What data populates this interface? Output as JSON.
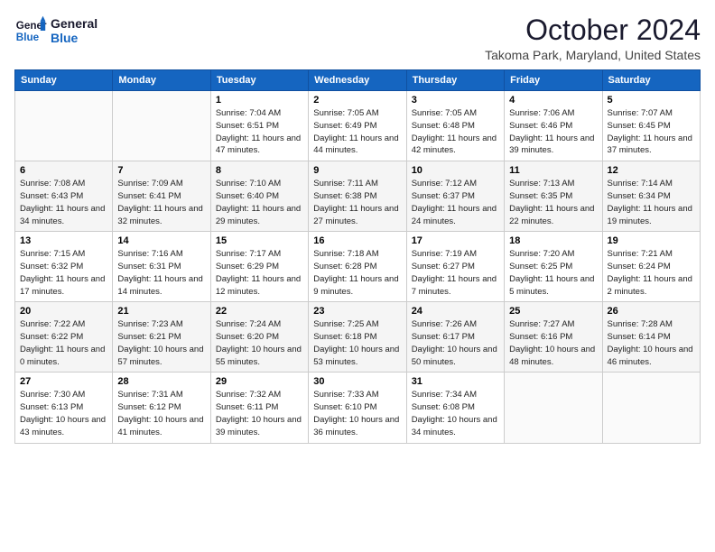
{
  "header": {
    "logo_line1": "General",
    "logo_line2": "Blue",
    "month": "October 2024",
    "location": "Takoma Park, Maryland, United States"
  },
  "weekdays": [
    "Sunday",
    "Monday",
    "Tuesday",
    "Wednesday",
    "Thursday",
    "Friday",
    "Saturday"
  ],
  "weeks": [
    [
      {
        "day": "",
        "info": ""
      },
      {
        "day": "",
        "info": ""
      },
      {
        "day": "1",
        "info": "Sunrise: 7:04 AM\nSunset: 6:51 PM\nDaylight: 11 hours and 47 minutes."
      },
      {
        "day": "2",
        "info": "Sunrise: 7:05 AM\nSunset: 6:49 PM\nDaylight: 11 hours and 44 minutes."
      },
      {
        "day": "3",
        "info": "Sunrise: 7:05 AM\nSunset: 6:48 PM\nDaylight: 11 hours and 42 minutes."
      },
      {
        "day": "4",
        "info": "Sunrise: 7:06 AM\nSunset: 6:46 PM\nDaylight: 11 hours and 39 minutes."
      },
      {
        "day": "5",
        "info": "Sunrise: 7:07 AM\nSunset: 6:45 PM\nDaylight: 11 hours and 37 minutes."
      }
    ],
    [
      {
        "day": "6",
        "info": "Sunrise: 7:08 AM\nSunset: 6:43 PM\nDaylight: 11 hours and 34 minutes."
      },
      {
        "day": "7",
        "info": "Sunrise: 7:09 AM\nSunset: 6:41 PM\nDaylight: 11 hours and 32 minutes."
      },
      {
        "day": "8",
        "info": "Sunrise: 7:10 AM\nSunset: 6:40 PM\nDaylight: 11 hours and 29 minutes."
      },
      {
        "day": "9",
        "info": "Sunrise: 7:11 AM\nSunset: 6:38 PM\nDaylight: 11 hours and 27 minutes."
      },
      {
        "day": "10",
        "info": "Sunrise: 7:12 AM\nSunset: 6:37 PM\nDaylight: 11 hours and 24 minutes."
      },
      {
        "day": "11",
        "info": "Sunrise: 7:13 AM\nSunset: 6:35 PM\nDaylight: 11 hours and 22 minutes."
      },
      {
        "day": "12",
        "info": "Sunrise: 7:14 AM\nSunset: 6:34 PM\nDaylight: 11 hours and 19 minutes."
      }
    ],
    [
      {
        "day": "13",
        "info": "Sunrise: 7:15 AM\nSunset: 6:32 PM\nDaylight: 11 hours and 17 minutes."
      },
      {
        "day": "14",
        "info": "Sunrise: 7:16 AM\nSunset: 6:31 PM\nDaylight: 11 hours and 14 minutes."
      },
      {
        "day": "15",
        "info": "Sunrise: 7:17 AM\nSunset: 6:29 PM\nDaylight: 11 hours and 12 minutes."
      },
      {
        "day": "16",
        "info": "Sunrise: 7:18 AM\nSunset: 6:28 PM\nDaylight: 11 hours and 9 minutes."
      },
      {
        "day": "17",
        "info": "Sunrise: 7:19 AM\nSunset: 6:27 PM\nDaylight: 11 hours and 7 minutes."
      },
      {
        "day": "18",
        "info": "Sunrise: 7:20 AM\nSunset: 6:25 PM\nDaylight: 11 hours and 5 minutes."
      },
      {
        "day": "19",
        "info": "Sunrise: 7:21 AM\nSunset: 6:24 PM\nDaylight: 11 hours and 2 minutes."
      }
    ],
    [
      {
        "day": "20",
        "info": "Sunrise: 7:22 AM\nSunset: 6:22 PM\nDaylight: 11 hours and 0 minutes."
      },
      {
        "day": "21",
        "info": "Sunrise: 7:23 AM\nSunset: 6:21 PM\nDaylight: 10 hours and 57 minutes."
      },
      {
        "day": "22",
        "info": "Sunrise: 7:24 AM\nSunset: 6:20 PM\nDaylight: 10 hours and 55 minutes."
      },
      {
        "day": "23",
        "info": "Sunrise: 7:25 AM\nSunset: 6:18 PM\nDaylight: 10 hours and 53 minutes."
      },
      {
        "day": "24",
        "info": "Sunrise: 7:26 AM\nSunset: 6:17 PM\nDaylight: 10 hours and 50 minutes."
      },
      {
        "day": "25",
        "info": "Sunrise: 7:27 AM\nSunset: 6:16 PM\nDaylight: 10 hours and 48 minutes."
      },
      {
        "day": "26",
        "info": "Sunrise: 7:28 AM\nSunset: 6:14 PM\nDaylight: 10 hours and 46 minutes."
      }
    ],
    [
      {
        "day": "27",
        "info": "Sunrise: 7:30 AM\nSunset: 6:13 PM\nDaylight: 10 hours and 43 minutes."
      },
      {
        "day": "28",
        "info": "Sunrise: 7:31 AM\nSunset: 6:12 PM\nDaylight: 10 hours and 41 minutes."
      },
      {
        "day": "29",
        "info": "Sunrise: 7:32 AM\nSunset: 6:11 PM\nDaylight: 10 hours and 39 minutes."
      },
      {
        "day": "30",
        "info": "Sunrise: 7:33 AM\nSunset: 6:10 PM\nDaylight: 10 hours and 36 minutes."
      },
      {
        "day": "31",
        "info": "Sunrise: 7:34 AM\nSunset: 6:08 PM\nDaylight: 10 hours and 34 minutes."
      },
      {
        "day": "",
        "info": ""
      },
      {
        "day": "",
        "info": ""
      }
    ]
  ]
}
